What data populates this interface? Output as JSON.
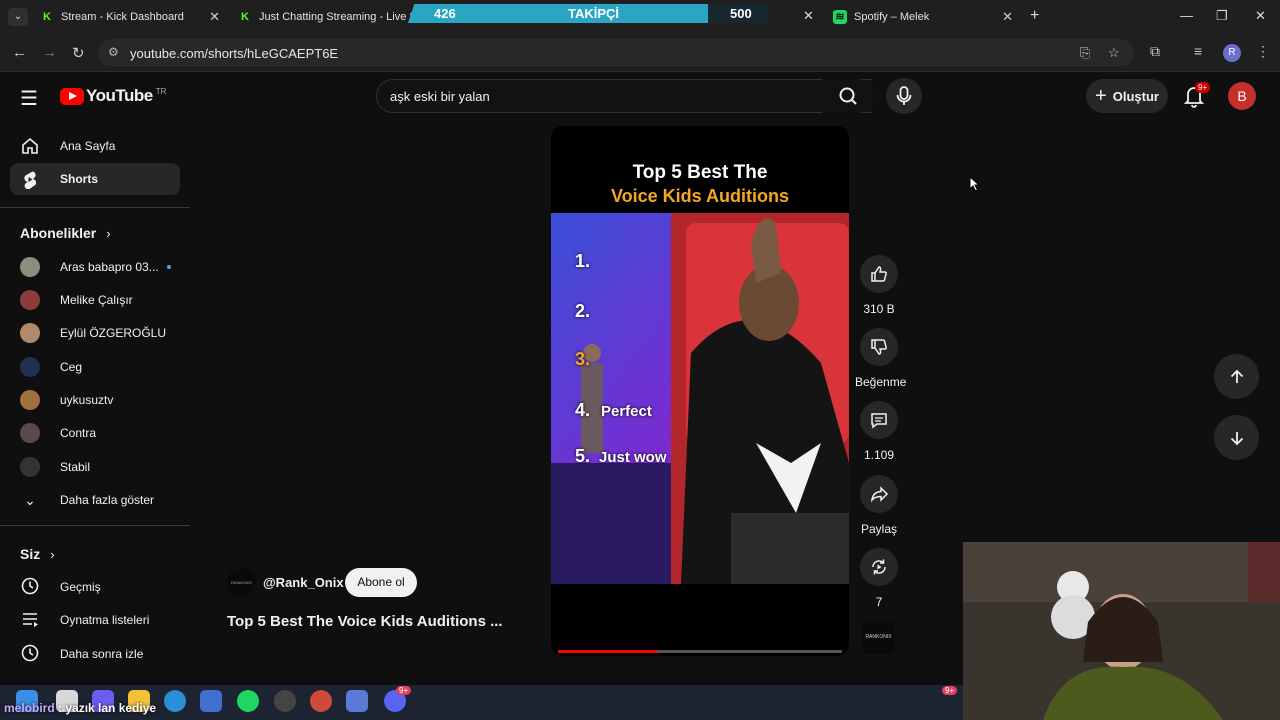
{
  "browser": {
    "tabs": [
      {
        "title": "Stream - Kick Dashboard"
      },
      {
        "title": "Just Chatting Streaming - Live S"
      },
      {
        "title": "Spotify – Melek"
      }
    ],
    "url": "youtube.com/shorts/hLeGCAEPT6E",
    "profile_letter": "R"
  },
  "follow_goal": {
    "current": "426",
    "label": "TAKİPÇİ",
    "target": "500"
  },
  "header": {
    "logo_text": "YouTube",
    "country": "TR",
    "search_query": "aşk eski bir yalan",
    "create_label": "Oluştur",
    "notif_count": "9+",
    "avatar_letter": "B"
  },
  "sidebar": {
    "main": [
      {
        "label": "Ana Sayfa"
      },
      {
        "label": "Shorts"
      }
    ],
    "subs_heading": "Abonelikler",
    "subscriptions": [
      {
        "label": "Aras babapro 03...",
        "color": "#8a8f7a",
        "live_dot": true
      },
      {
        "label": "Melike Çalışır",
        "color": "#8c3c3c"
      },
      {
        "label": "Eylül ÖZGEROĞLU",
        "color": "#b08a6a"
      },
      {
        "label": "Ceg",
        "color": "#203050"
      },
      {
        "label": "uykusuztv",
        "color": "#a07040"
      },
      {
        "label": "Contra",
        "color": "#5a4a4a"
      },
      {
        "label": "Stabil",
        "color": "#333333"
      }
    ],
    "show_more": "Daha fazla göster",
    "you_heading": "Siz",
    "you_items": [
      {
        "label": "Geçmiş"
      },
      {
        "label": "Oynatma listeleri"
      },
      {
        "label": "Daha sonra izle"
      }
    ]
  },
  "short": {
    "title_line1": "Top 5 Best The",
    "title_line2": "Voice Kids Auditions",
    "ranks": [
      "1.",
      "2.",
      "3.",
      "4.",
      "5."
    ],
    "rank4_text": "Perfect",
    "rank5_text": "Just wow",
    "progress": 0.35,
    "channel_thumb_text": "RANKONIX",
    "handle": "@Rank_Onix",
    "subscribe_label": "Abone ol",
    "video_title": "Top 5 Best The Voice Kids Auditions ..."
  },
  "actions": {
    "likes": "310 B",
    "dislike_label": "Beğenme",
    "comments": "1.109",
    "share_label": "Paylaş",
    "remix_count": "7"
  },
  "stream_chat": {
    "user": "melobird",
    "message": "yazık lan kediye"
  },
  "taskbar": {
    "badge1": "9+",
    "badge2": "9+"
  }
}
